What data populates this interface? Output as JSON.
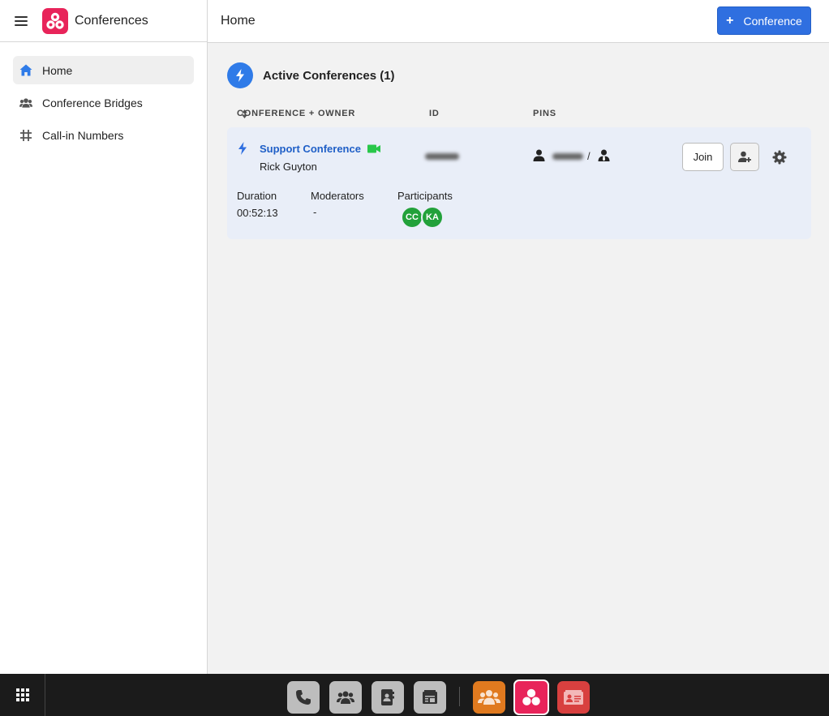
{
  "app": {
    "title": "Conferences"
  },
  "sidebar": {
    "items": [
      {
        "label": "Home",
        "icon": "home-icon"
      },
      {
        "label": "Conference Bridges",
        "icon": "users-icon"
      },
      {
        "label": "Call-in Numbers",
        "icon": "hash-icon"
      }
    ]
  },
  "topbar": {
    "title": "Home",
    "add_button_label": "Conference"
  },
  "section": {
    "title": "Active Conferences (1)"
  },
  "columns": {
    "conference_owner": "CONFERENCE + OWNER",
    "id": "ID",
    "pins": "PINS"
  },
  "conference": {
    "name": "Support Conference",
    "owner": "Rick Guyton",
    "pin_separator": "/",
    "join_label": "Join",
    "duration_label": "Duration",
    "duration_value": "00:52:13",
    "moderators_label": "Moderators",
    "moderators_value": "-",
    "participants_label": "Participants",
    "participants": [
      "CC",
      "KA"
    ]
  },
  "colors": {
    "accent": "#2f6fe0",
    "brand": "#e8245a",
    "participant_avatar": "#22a13a",
    "video_icon": "#29c74a"
  },
  "dock": {
    "apps": [
      "phone-icon",
      "contacts-group-icon",
      "address-book-icon",
      "fax-icon",
      "meetings-icon",
      "conferences-icon",
      "directory-icon"
    ]
  }
}
